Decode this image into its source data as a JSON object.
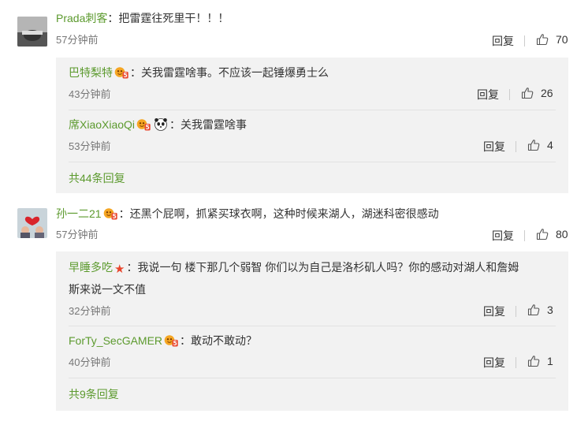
{
  "comments": [
    {
      "user": "Prada刺客",
      "text": "：把雷霆往死里干！！！",
      "time": "57分钟前",
      "reply_label": "回复",
      "likes": "70",
      "replies": [
        {
          "user": "巴特梨特",
          "text": "：关我雷霆啥事。不应该一起锤爆勇士么",
          "time": "43分钟前",
          "reply_label": "回复",
          "likes": "26"
        },
        {
          "user": "席XiaoXiaoQi",
          "text": "：关我雷霆啥事",
          "time": "53分钟前",
          "reply_label": "回复",
          "likes": "4"
        }
      ],
      "more": "共44条回复"
    },
    {
      "user": "孙一二21",
      "text": "：还黑个屁啊，抓紧买球衣啊，这种时候来湖人，湖迷科密很感动",
      "time": "57分钟前",
      "reply_label": "回复",
      "likes": "80",
      "replies": [
        {
          "user": "早睡多吃",
          "text": "：我说一句 楼下那几个弱智 你们以为自己是洛杉矶人吗？你的感动对湖人和詹姆",
          "text2": "斯来说一文不值",
          "time": "32分钟前",
          "reply_label": "回复",
          "likes": "3"
        },
        {
          "user": "ForTy_SecGAMER",
          "text": "：敢动不敢动？",
          "time": "40分钟前",
          "reply_label": "回复",
          "likes": "1"
        }
      ],
      "more": "共9条回复"
    }
  ],
  "icons": {
    "like": "thumbs-up-icon",
    "badge": "vip-badge-icon",
    "star": "star-icon",
    "panda": "panda-emoji-icon"
  },
  "colors": {
    "username": "#5c9a2e",
    "reply_bg": "#f2f2f2",
    "text": "#333333",
    "muted": "#777777"
  }
}
